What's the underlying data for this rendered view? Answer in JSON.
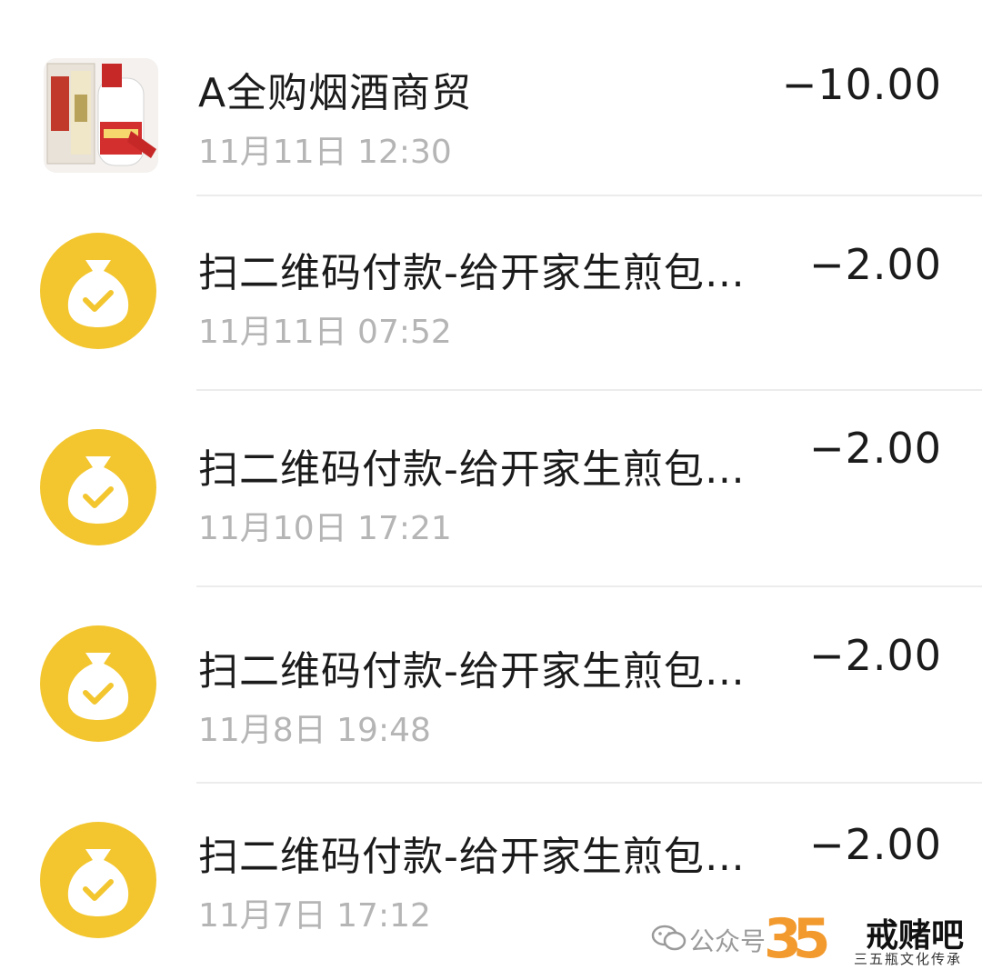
{
  "transactions": [
    {
      "title": "A全购烟酒商贸",
      "time": "11月11日 12:30",
      "amount": "−10.00",
      "avatar": "product-bottle-image"
    },
    {
      "title": "扫二维码付款-给开家生煎包…",
      "time": "11月11日 07:52",
      "amount": "−2.00",
      "avatar": "money-bag-check-icon"
    },
    {
      "title": "扫二维码付款-给开家生煎包…",
      "time": "11月10日 17:21",
      "amount": "−2.00",
      "avatar": "money-bag-check-icon"
    },
    {
      "title": "扫二维码付款-给开家生煎包…",
      "time": "11月8日 19:48",
      "amount": "−2.00",
      "avatar": "money-bag-check-icon"
    },
    {
      "title": "扫二维码付款-给开家生煎包…",
      "time": "11月7日 17:12",
      "amount": "−2.00",
      "avatar": "money-bag-check-icon"
    }
  ],
  "watermark": {
    "account_label": "公众号",
    "brand": "戒赌吧",
    "number": "35",
    "subtitle": "三五瓶文化传承"
  },
  "colors": {
    "coin_yellow": "#f3c62f",
    "time_gray": "#b5b5b5",
    "text_dark": "#1b1b1b"
  }
}
